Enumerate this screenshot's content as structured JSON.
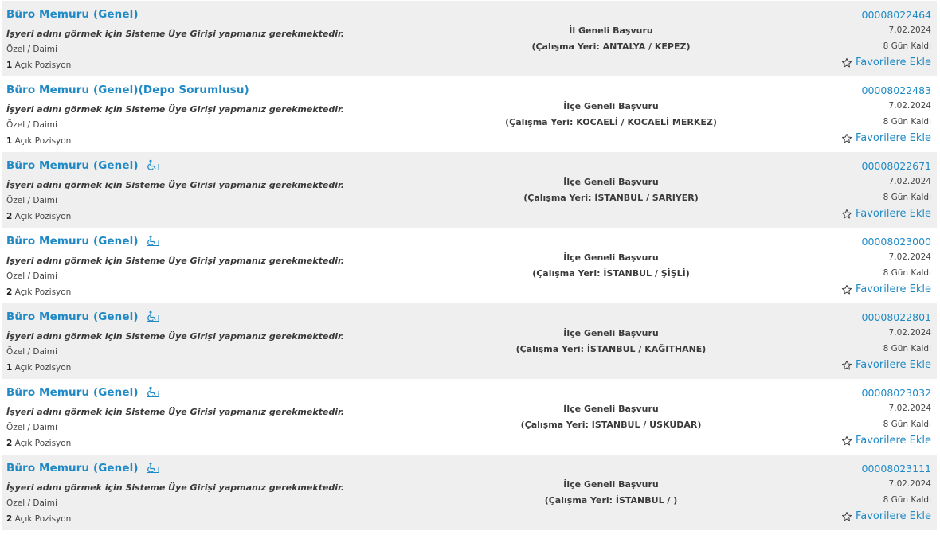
{
  "favorite_label": "Favorilere Ekle",
  "positions_suffix": "Açık Pozisyon",
  "colors": {
    "link": "#1f8ac6",
    "row_alt": "#efefef"
  },
  "listings": [
    {
      "title": "Büro Memuru (Genel)",
      "disabled_quota": false,
      "company": "İşyeri adını görmek için Sisteme Üye Girişi yapmanız gerekmektedir.",
      "type": "Özel / Daimi",
      "positions": "1",
      "scope": "İl Geneli Başvuru",
      "location": "(Çalışma Yeri: ANTALYA / KEPEZ)",
      "code": "00008022464",
      "date": "7.02.2024",
      "remaining": "8 Gün Kaldı"
    },
    {
      "title": "Büro Memuru (Genel)(Depo Sorumlusu)",
      "disabled_quota": false,
      "company": "İşyeri adını görmek için Sisteme Üye Girişi yapmanız gerekmektedir.",
      "type": "Özel / Daimi",
      "positions": "1",
      "scope": "İlçe Geneli Başvuru",
      "location": "(Çalışma Yeri: KOCAELİ / KOCAELİ MERKEZ)",
      "code": "00008022483",
      "date": "7.02.2024",
      "remaining": "8 Gün Kaldı"
    },
    {
      "title": "Büro Memuru (Genel)",
      "disabled_quota": true,
      "company": "İşyeri adını görmek için Sisteme Üye Girişi yapmanız gerekmektedir.",
      "type": "Özel / Daimi",
      "positions": "2",
      "scope": "İlçe Geneli Başvuru",
      "location": "(Çalışma Yeri: İSTANBUL / SARIYER)",
      "code": "00008022671",
      "date": "7.02.2024",
      "remaining": "8 Gün Kaldı"
    },
    {
      "title": "Büro Memuru (Genel)",
      "disabled_quota": true,
      "company": "İşyeri adını görmek için Sisteme Üye Girişi yapmanız gerekmektedir.",
      "type": "Özel / Daimi",
      "positions": "2",
      "scope": "İlçe Geneli Başvuru",
      "location": "(Çalışma Yeri: İSTANBUL / ŞİŞLİ)",
      "code": "00008023000",
      "date": "7.02.2024",
      "remaining": "8 Gün Kaldı"
    },
    {
      "title": "Büro Memuru (Genel)",
      "disabled_quota": true,
      "company": "İşyeri adını görmek için Sisteme Üye Girişi yapmanız gerekmektedir.",
      "type": "Özel / Daimi",
      "positions": "1",
      "scope": "İlçe Geneli Başvuru",
      "location": "(Çalışma Yeri: İSTANBUL / KAĞITHANE)",
      "code": "00008022801",
      "date": "7.02.2024",
      "remaining": "8 Gün Kaldı"
    },
    {
      "title": "Büro Memuru (Genel)",
      "disabled_quota": true,
      "company": "İşyeri adını görmek için Sisteme Üye Girişi yapmanız gerekmektedir.",
      "type": "Özel / Daimi",
      "positions": "2",
      "scope": "İlçe Geneli Başvuru",
      "location": "(Çalışma Yeri: İSTANBUL / ÜSKÜDAR)",
      "code": "00008023032",
      "date": "7.02.2024",
      "remaining": "8 Gün Kaldı"
    },
    {
      "title": "Büro Memuru (Genel)",
      "disabled_quota": true,
      "company": "İşyeri adını görmek için Sisteme Üye Girişi yapmanız gerekmektedir.",
      "type": "Özel / Daimi",
      "positions": "2",
      "scope": "İlçe Geneli Başvuru",
      "location": "(Çalışma Yeri: İSTANBUL / )",
      "code": "00008023111",
      "date": "7.02.2024",
      "remaining": "8 Gün Kaldı"
    }
  ]
}
